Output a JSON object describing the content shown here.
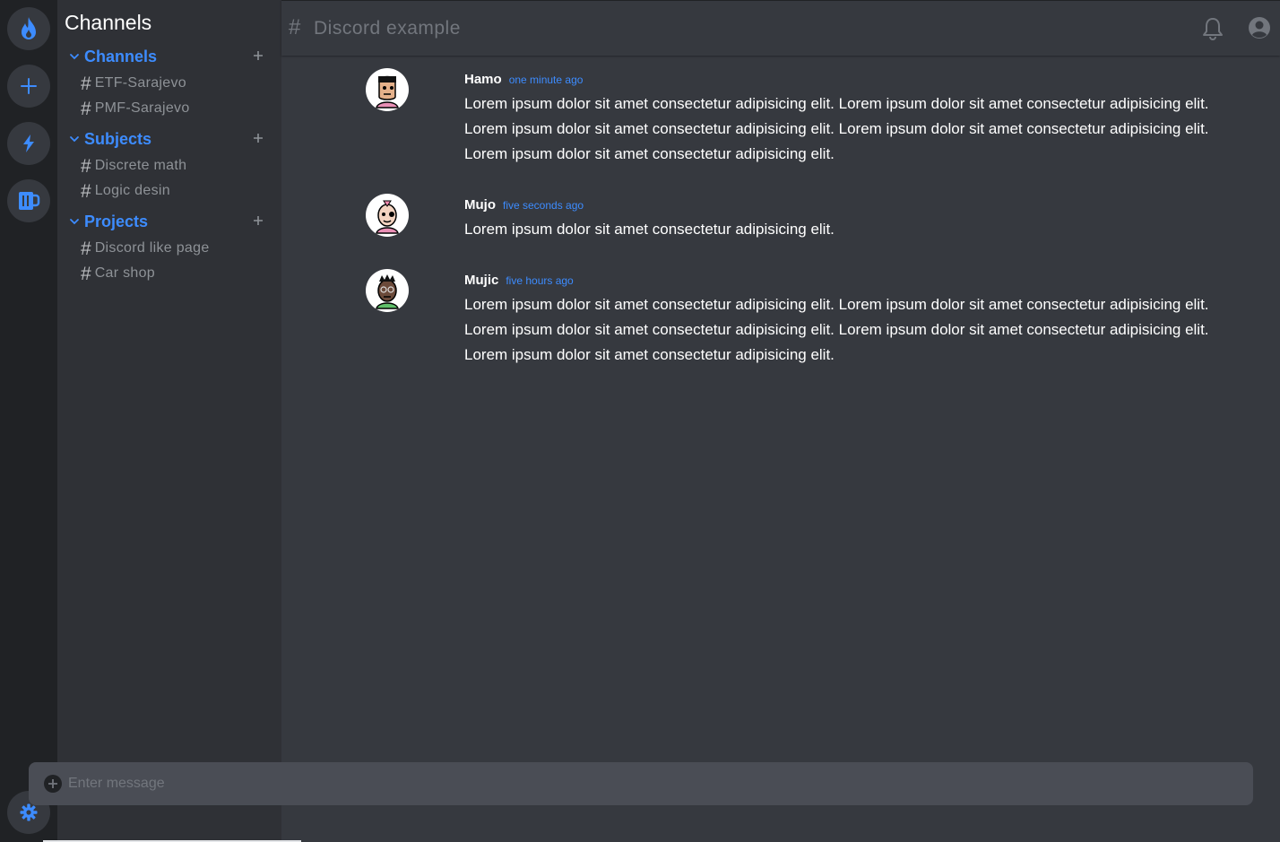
{
  "rail": {
    "items": [
      {
        "icon": "fire-icon"
      },
      {
        "icon": "plus-icon"
      },
      {
        "icon": "lightning-icon"
      },
      {
        "icon": "mug-icon"
      }
    ],
    "settings_icon": "gear-icon"
  },
  "sidebar": {
    "title": "Channels",
    "categories": [
      {
        "label": "Channels",
        "channels": [
          "ETF-Sarajevo",
          "PMF-Sarajevo"
        ]
      },
      {
        "label": "Subjects",
        "channels": [
          "Discrete math",
          "Logic desin"
        ]
      },
      {
        "label": "Projects",
        "channels": [
          "Discord like page",
          "Car shop"
        ]
      }
    ],
    "hash": "#"
  },
  "header": {
    "hash": "#",
    "title": "Discord example",
    "icons": [
      "bell-icon",
      "user-circle-icon"
    ]
  },
  "messages": [
    {
      "author": "Hamo",
      "time": "one minute ago",
      "text": "Lorem ipsum dolor sit amet consectetur adipisicing elit. Lorem ipsum dolor sit amet consectetur adipisicing elit. Lorem ipsum dolor sit amet consectetur adipisicing elit. Lorem ipsum dolor sit amet consectetur adipisicing elit. Lorem ipsum dolor sit amet consectetur adipisicing elit."
    },
    {
      "author": "Mujo",
      "time": "five seconds ago",
      "text": "Lorem ipsum dolor sit amet consectetur adipisicing elit."
    },
    {
      "author": "Mujic",
      "time": "five hours ago",
      "text": "Lorem ipsum dolor sit amet consectetur adipisicing elit. Lorem ipsum dolor sit amet consectetur adipisicing elit. Lorem ipsum dolor sit amet consectetur adipisicing elit. Lorem ipsum dolor sit amet consectetur adipisicing elit. Lorem ipsum dolor sit amet consectetur adipisicing elit."
    }
  ],
  "composer": {
    "placeholder": "Enter message",
    "value": ""
  },
  "colors": {
    "accent": "#3d8cff",
    "rail_bg": "#202225",
    "sidebar_bg": "#2f3136",
    "main_bg": "#36393f",
    "composer_bg": "#4a4d55"
  }
}
